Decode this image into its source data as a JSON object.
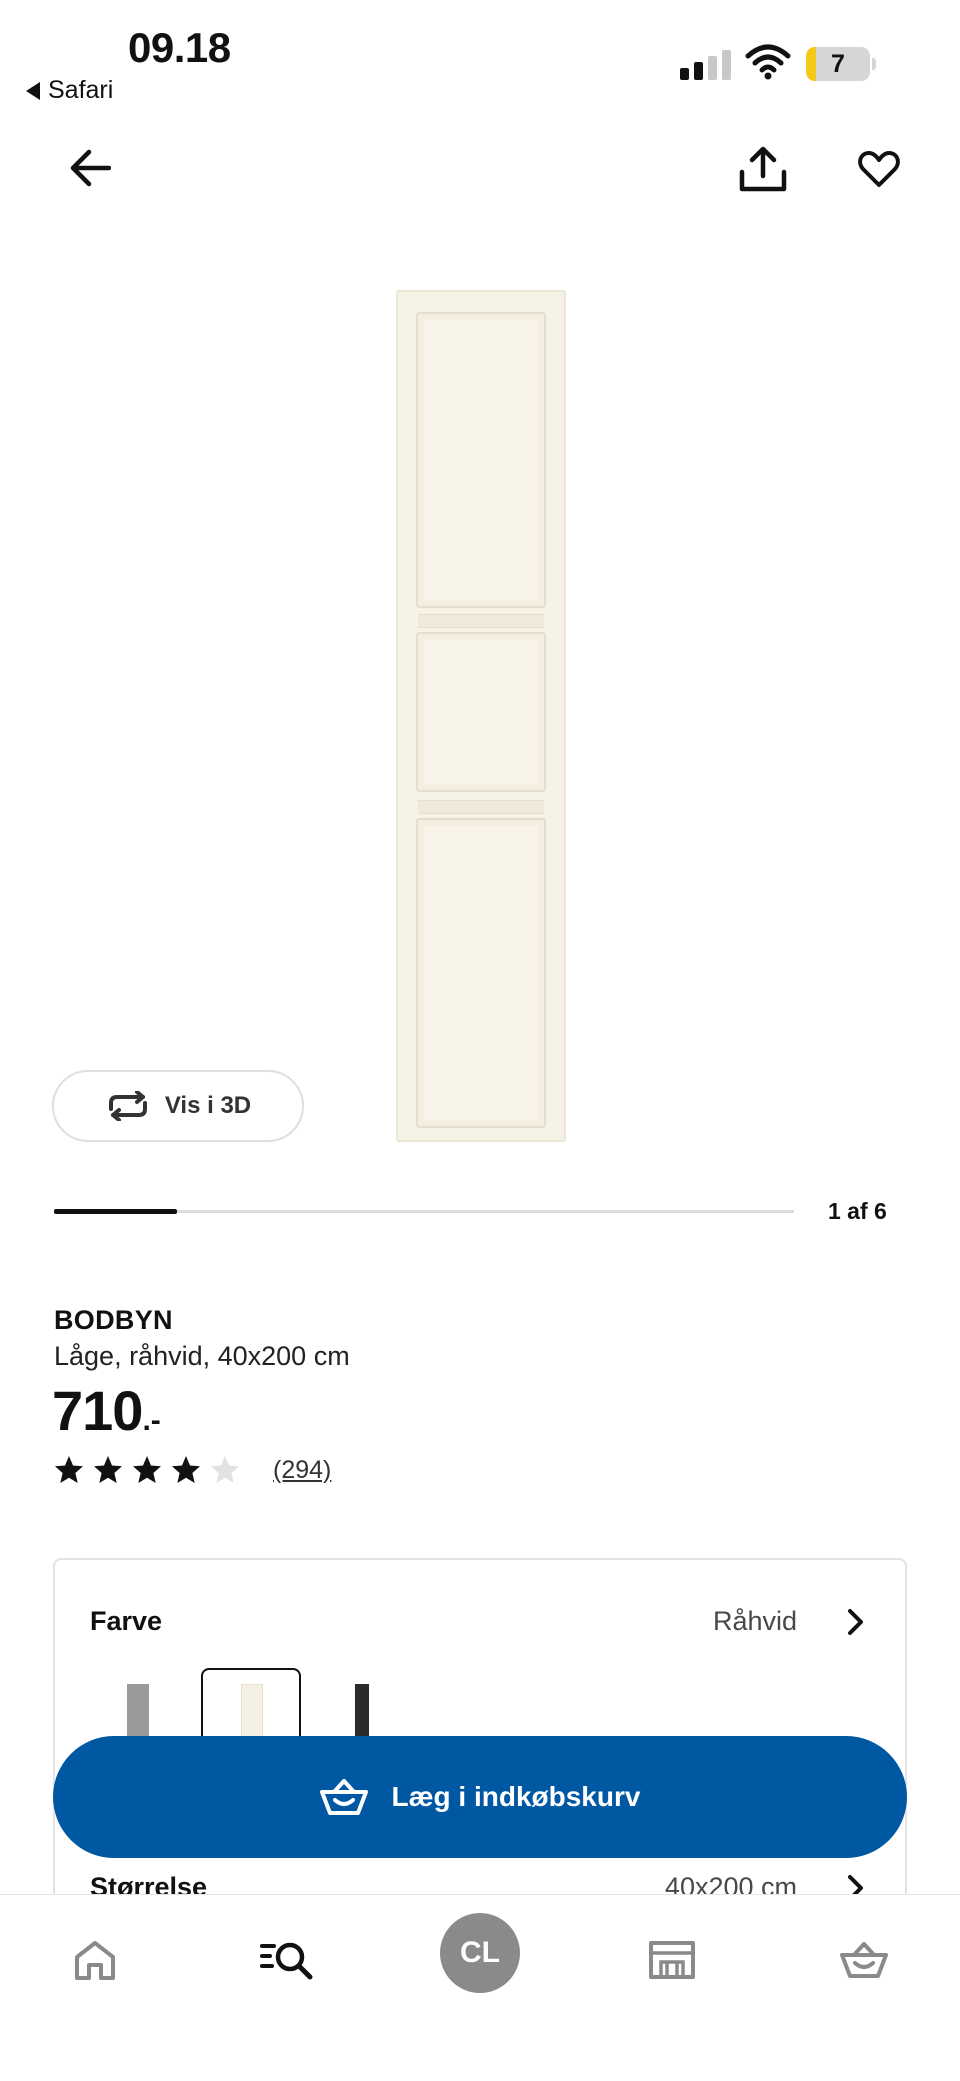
{
  "status_bar": {
    "time": "09.18",
    "back_app": "Safari",
    "battery": "7"
  },
  "gallery": {
    "vis3d_label": "Vis i 3D",
    "page_indicator": "1 af 6",
    "progress_fraction": 0.1667
  },
  "product": {
    "name": "BODBYN",
    "description": "Låge, råhvid, 40x200 cm",
    "price": "710",
    "price_suffix": ".-",
    "rating": 4,
    "rating_max": 5,
    "review_count": "(294)"
  },
  "options": {
    "color_label": "Farve",
    "color_value": "Råhvid",
    "size_label": "Størrelse",
    "size_value": "40x200 cm",
    "swatches": [
      {
        "name": "grey",
        "color": "#9a9a9a"
      },
      {
        "name": "off-white",
        "color": "#f3efe2"
      },
      {
        "name": "black",
        "color": "#2b2b2b"
      }
    ]
  },
  "cta": {
    "add_to_cart_label": "Læg i indkøbskurv",
    "color": "#0058a3"
  },
  "tab_bar": {
    "items": [
      "home-icon",
      "search-icon",
      "profile-avatar",
      "store-icon",
      "basket-icon"
    ],
    "avatar_initials": "CL"
  }
}
